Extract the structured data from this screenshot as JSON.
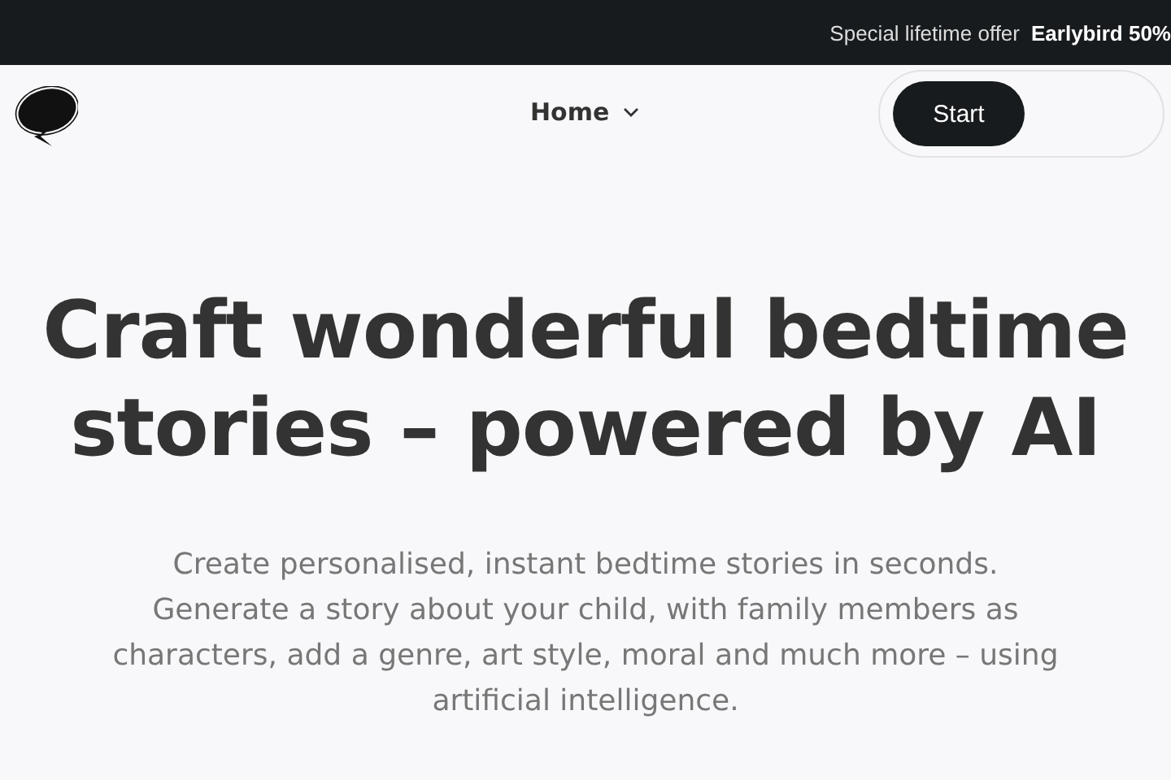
{
  "banner": {
    "label": "Special lifetime offer",
    "offer": "Earlybird 50%"
  },
  "nav": {
    "items": [
      {
        "label": "Home",
        "expandable": true
      }
    ],
    "start_button": "Start"
  },
  "hero": {
    "title": "Craft wonderful bedtime stories – powered by AI",
    "subtitle": "Create personalised, instant bedtime stories in seconds. Generate a story about your child, with family members as characters, add a genre, art style, moral and much more – using artificial intelligence."
  }
}
